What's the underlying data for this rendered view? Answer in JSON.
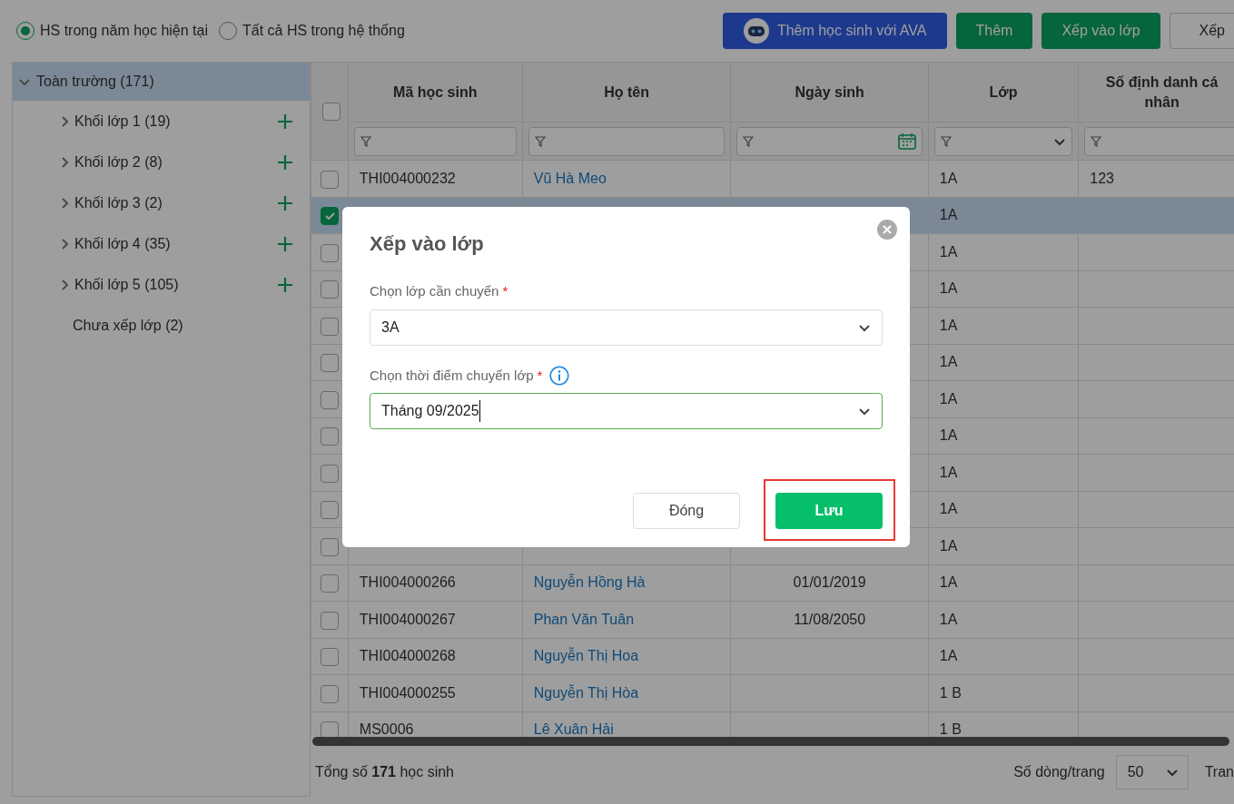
{
  "filter_options": [
    {
      "label": "HS trong năm học hiện tại",
      "selected": true
    },
    {
      "label": "Tất cả HS trong hệ thống",
      "selected": false
    }
  ],
  "toolbar_buttons": [
    {
      "label": "Thêm học sinh với AVA",
      "kind": "ava"
    },
    {
      "label": "Thêm",
      "kind": "primary"
    },
    {
      "label": "Xếp vào lớp",
      "kind": "primary"
    },
    {
      "label": "Xếp",
      "kind": "outline"
    }
  ],
  "tree": {
    "label": "Toàn trường (171)",
    "expanded": true,
    "selected": true,
    "children": [
      {
        "label": "Khối lớp 1 (19)",
        "kind": "group"
      },
      {
        "label": "Khối lớp 2 (8)",
        "kind": "group"
      },
      {
        "label": "Khối lớp 3 (2)",
        "kind": "group"
      },
      {
        "label": "Khối lớp 4 (35)",
        "kind": "group"
      },
      {
        "label": "Khối lớp 5 (105)",
        "kind": "group"
      },
      {
        "label": "Chưa xếp lớp (2)",
        "kind": "leaf"
      }
    ]
  },
  "table": {
    "all_checked": false,
    "columns": [
      {
        "label": "Mã học sinh",
        "kind": "text"
      },
      {
        "label": "Họ tên",
        "kind": "text"
      },
      {
        "label": "Ngày sinh",
        "kind": "date"
      },
      {
        "label": "Lớp",
        "kind": "select"
      },
      {
        "label": "Số định danh cá nhân",
        "kind": "text"
      }
    ],
    "rows": [
      {
        "checked": false,
        "student_id": "THI004000232",
        "full_name": "Vũ Hà Meo",
        "class_name": "1A",
        "personal_id": "123"
      },
      {
        "checked": true,
        "class_name": "1A"
      },
      {
        "checked": false,
        "class_name": "1A"
      },
      {
        "checked": false,
        "class_name": "1A"
      },
      {
        "checked": false,
        "class_name": "1A"
      },
      {
        "checked": false,
        "class_name": "1A"
      },
      {
        "checked": false,
        "class_name": "1A"
      },
      {
        "checked": false,
        "class_name": "1A"
      },
      {
        "checked": false,
        "class_name": "1A"
      },
      {
        "checked": false,
        "class_name": "1A"
      },
      {
        "checked": false,
        "class_name": "1A"
      },
      {
        "checked": false,
        "student_id": "THI004000266",
        "full_name": "Nguyễn Hồng Hà",
        "birth_date": "01/01/2019",
        "class_name": "1A"
      },
      {
        "checked": false,
        "student_id": "THI004000267",
        "full_name": "Phan Văn Tuân",
        "birth_date": "11/08/2050",
        "class_name": "1A"
      },
      {
        "checked": false,
        "student_id": "THI004000268",
        "full_name": "Nguyễn Thị Hoa",
        "class_name": "1A"
      },
      {
        "checked": false,
        "student_id": "THI004000255",
        "full_name": "Nguyễn Thị Hòa",
        "class_name": "1 B"
      },
      {
        "checked": false,
        "student_id": "MS0006",
        "full_name": "Lê Xuân Hải",
        "class_name": "1 B"
      }
    ]
  },
  "footer": {
    "total": "Tổng số **171** học sinh",
    "page_size_label": "Số dòng/trang",
    "page_size": "50",
    "page_label": "Tran"
  },
  "dialog": {
    "title": "Xếp vào lớp",
    "fields": [
      {
        "label": "Chọn lớp cần chuyển",
        "required_mark": "*",
        "info": false,
        "value": "3A",
        "focused": false
      },
      {
        "label": "Chọn thời điểm chuyển lớp",
        "required_mark": "*",
        "info": true,
        "value": "Tháng 09/2025",
        "focused": true
      }
    ],
    "buttons": [
      {
        "label": "Đóng",
        "kind": "secondary",
        "highlighted": false
      },
      {
        "label": "Lưu",
        "kind": "primary",
        "highlighted": true
      }
    ]
  }
}
